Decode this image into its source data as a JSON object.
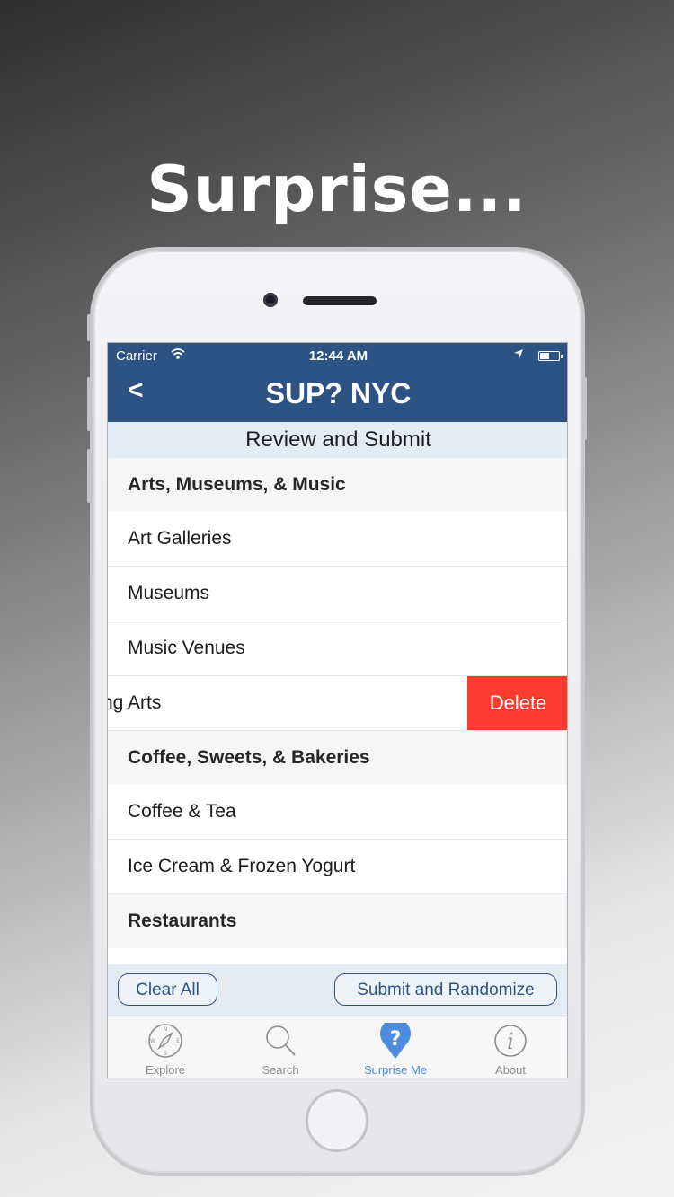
{
  "headline": "Surprise...",
  "status_bar": {
    "carrier": "Carrier",
    "time": "12:44 AM"
  },
  "nav": {
    "back_label": "<",
    "title": "SUP? NYC"
  },
  "subheader": "Review and Submit",
  "list": {
    "rows": [
      {
        "label": "Arts, Museums, & Music",
        "type": "section"
      },
      {
        "label": "Art Galleries",
        "type": "item"
      },
      {
        "label": "Museums",
        "type": "item"
      },
      {
        "label": "Music Venues",
        "type": "item"
      },
      {
        "label": "ng Arts",
        "type": "item-swiped"
      },
      {
        "label": "Coffee, Sweets, & Bakeries",
        "type": "section"
      },
      {
        "label": "Coffee & Tea",
        "type": "item"
      },
      {
        "label": "Ice Cream & Frozen Yogurt",
        "type": "item"
      },
      {
        "label": "Restaurants",
        "type": "section"
      }
    ],
    "delete_label": "Delete"
  },
  "actions": {
    "clear_label": "Clear All",
    "submit_label": "Submit and Randomize"
  },
  "tabbar": {
    "tabs": [
      {
        "label": "Explore",
        "icon": "compass-icon",
        "active": false
      },
      {
        "label": "Search",
        "icon": "search-icon",
        "active": false
      },
      {
        "label": "Surprise Me",
        "icon": "question-pin-icon",
        "active": true
      },
      {
        "label": "About",
        "icon": "info-icon",
        "active": false
      }
    ]
  },
  "colors": {
    "nav": "#2d5384",
    "delete": "#fc3b30",
    "active_tab": "#4d8be0",
    "subheader_bg": "#e4ebf3"
  }
}
